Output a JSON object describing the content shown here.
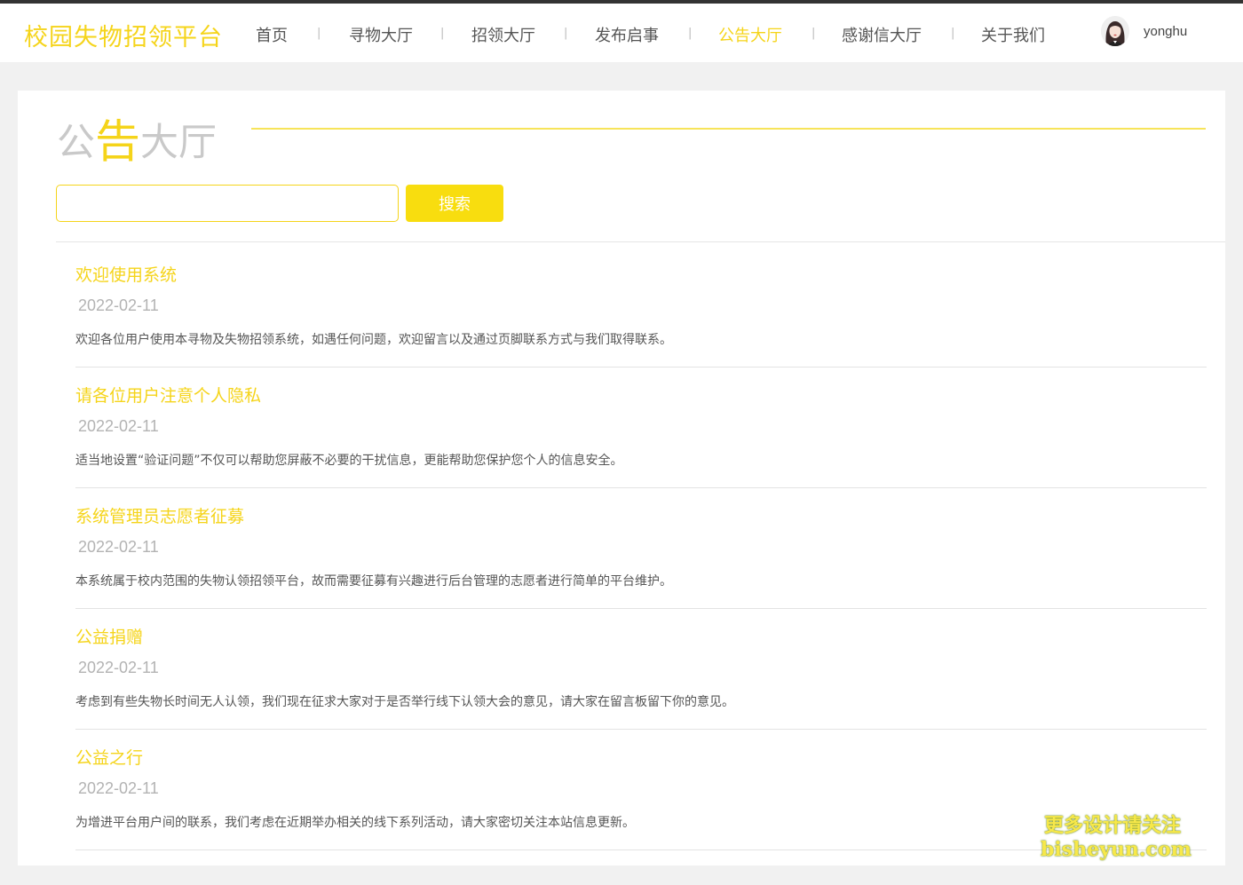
{
  "header": {
    "logo": "校园失物招领平台",
    "nav": [
      {
        "label": "首页",
        "active": false
      },
      {
        "label": "寻物大厅",
        "active": false
      },
      {
        "label": "招领大厅",
        "active": false
      },
      {
        "label": "发布启事",
        "active": false
      },
      {
        "label": "公告大厅",
        "active": true
      },
      {
        "label": "感谢信大厅",
        "active": false
      },
      {
        "label": "关于我们",
        "active": false
      }
    ],
    "separator": "|",
    "user": {
      "name": "yonghu",
      "avatar_icon": "user-avatar-photo"
    }
  },
  "page": {
    "title_part1": "公",
    "title_highlight": "告",
    "title_part2": "大厅"
  },
  "search": {
    "value": "",
    "placeholder": "",
    "button_label": "搜索"
  },
  "notices": [
    {
      "title": "欢迎使用系统",
      "date": "2022-02-11",
      "content": "欢迎各位用户使用本寻物及失物招领系统，如遇任何问题，欢迎留言以及通过页脚联系方式与我们取得联系。"
    },
    {
      "title": "请各位用户注意个人隐私",
      "date": "2022-02-11",
      "content": "适当地设置“验证问题”不仅可以帮助您屏蔽不必要的干扰信息，更能帮助您保护您个人的信息安全。"
    },
    {
      "title": "系统管理员志愿者征募",
      "date": "2022-02-11",
      "content": "本系统属于校内范围的失物认领招领平台，故而需要征募有兴趣进行后台管理的志愿者进行简单的平台维护。"
    },
    {
      "title": "公益捐赠",
      "date": "2022-02-11",
      "content": "考虑到有些失物长时间无人认领，我们现在征求大家对于是否举行线下认领大会的意见，请大家在留言板留下你的意见。"
    },
    {
      "title": "公益之行",
      "date": "2022-02-11",
      "content": "为增进平台用户间的联系，我们考虑在近期举办相关的线下系列活动，请大家密切关注本站信息更新。"
    }
  ],
  "watermark": {
    "line1": "更多设计请关注",
    "line2": "bisheyun.com"
  },
  "colors": {
    "accent": "#f5d41a",
    "button": "#f8dd0f",
    "text": "#555555",
    "muted": "#b3b3b3"
  }
}
